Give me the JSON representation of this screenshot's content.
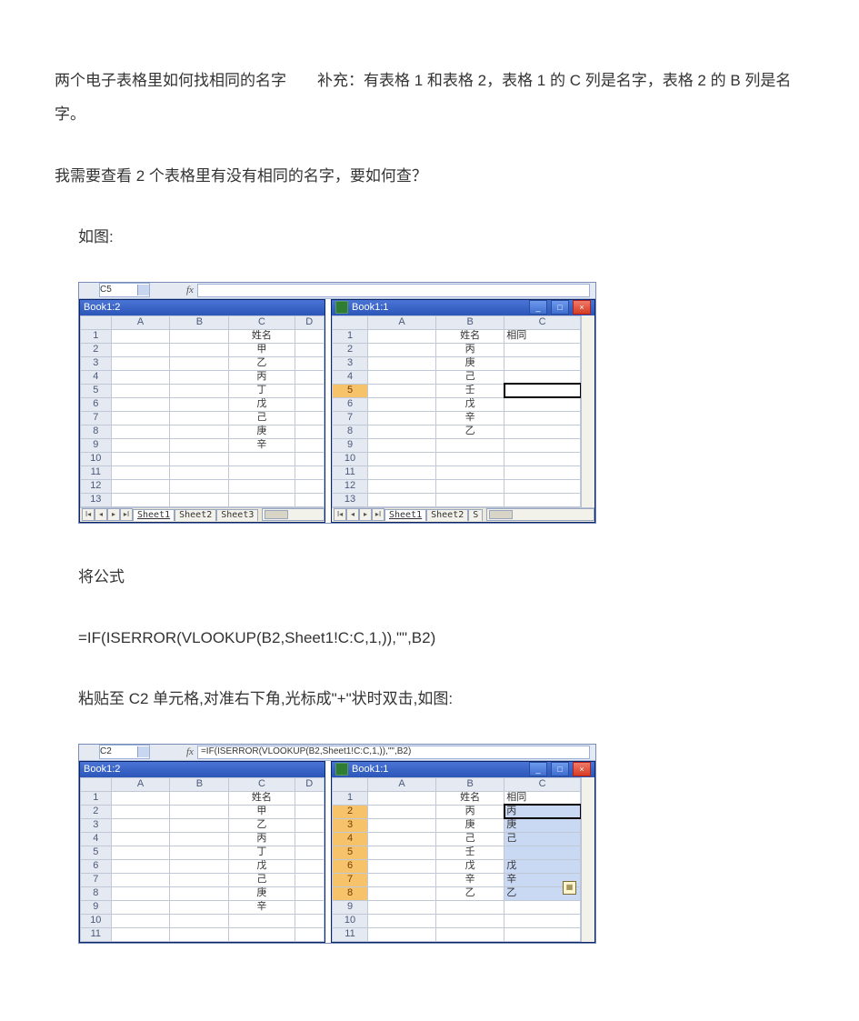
{
  "text": {
    "p1": "两个电子表格里如何找相同的名字  补充：有表格 1 和表格 2，表格 1 的 C 列是名字，表格 2 的 B 列是名字。",
    "p2": "我需要查看 2 个表格里有没有相同的名字，要如何查？",
    "p3": "如图:",
    "p4": "将公式",
    "p5": "=IF(ISERROR(VLOOKUP(B2,Sheet1!C:C,1,)),\"\",B2)",
    "p6": "粘贴至 C2 单元格,对准右下角,光标成\"+\"状时双击,如图:"
  },
  "shot1": {
    "nameBox": "C5",
    "fxLabel": "fx",
    "formula": "",
    "left": {
      "title": "Book1:2",
      "cols": [
        "A",
        "B",
        "C",
        "D"
      ],
      "rows": [
        {
          "n": "1",
          "C": "姓名"
        },
        {
          "n": "2",
          "C": "甲"
        },
        {
          "n": "3",
          "C": "乙"
        },
        {
          "n": "4",
          "C": "丙"
        },
        {
          "n": "5",
          "C": "丁"
        },
        {
          "n": "6",
          "C": "戊"
        },
        {
          "n": "7",
          "C": "己"
        },
        {
          "n": "8",
          "C": "庚"
        },
        {
          "n": "9",
          "C": "辛"
        },
        {
          "n": "10"
        },
        {
          "n": "11"
        },
        {
          "n": "12"
        },
        {
          "n": "13"
        }
      ],
      "tabs": [
        "Sheet1",
        "Sheet2",
        "Sheet3"
      ],
      "activeTab": 0
    },
    "right": {
      "title": "Book1:1",
      "cols": [
        "A",
        "B",
        "C"
      ],
      "rows": [
        {
          "n": "1",
          "B": "姓名",
          "C": "相同"
        },
        {
          "n": "2",
          "B": "丙"
        },
        {
          "n": "3",
          "B": "庚"
        },
        {
          "n": "4",
          "B": "己"
        },
        {
          "n": "5",
          "B": "壬",
          "active": "C"
        },
        {
          "n": "6",
          "B": "戊"
        },
        {
          "n": "7",
          "B": "辛"
        },
        {
          "n": "8",
          "B": "乙"
        },
        {
          "n": "9"
        },
        {
          "n": "10"
        },
        {
          "n": "11"
        },
        {
          "n": "12"
        },
        {
          "n": "13"
        }
      ],
      "selRow": "5",
      "tabs": [
        "Sheet1",
        "Sheet2",
        "S"
      ],
      "activeTab": 0,
      "winButtons": [
        "min",
        "max",
        "close"
      ]
    }
  },
  "shot2": {
    "nameBox": "C2",
    "fxLabel": "fx",
    "formula": "=IF(ISERROR(VLOOKUP(B2,Sheet1!C:C,1,)),\"\",B2)",
    "left": {
      "title": "Book1:2",
      "cols": [
        "A",
        "B",
        "C",
        "D"
      ],
      "rows": [
        {
          "n": "1",
          "C": "姓名"
        },
        {
          "n": "2",
          "C": "甲"
        },
        {
          "n": "3",
          "C": "乙"
        },
        {
          "n": "4",
          "C": "丙"
        },
        {
          "n": "5",
          "C": "丁"
        },
        {
          "n": "6",
          "C": "戊"
        },
        {
          "n": "7",
          "C": "己"
        },
        {
          "n": "8",
          "C": "庚"
        },
        {
          "n": "9",
          "C": "辛"
        },
        {
          "n": "10"
        },
        {
          "n": "11"
        }
      ]
    },
    "right": {
      "title": "Book1:1",
      "cols": [
        "A",
        "B",
        "C"
      ],
      "rows": [
        {
          "n": "1",
          "B": "姓名",
          "C": "相同"
        },
        {
          "n": "2",
          "B": "丙",
          "C": "丙",
          "sel": true,
          "active": true
        },
        {
          "n": "3",
          "B": "庚",
          "C": "庚",
          "sel": true
        },
        {
          "n": "4",
          "B": "己",
          "C": "己",
          "sel": true
        },
        {
          "n": "5",
          "B": "壬",
          "C": "",
          "sel": true
        },
        {
          "n": "6",
          "B": "戊",
          "C": "戊",
          "sel": true
        },
        {
          "n": "7",
          "B": "辛",
          "C": "辛",
          "sel": true
        },
        {
          "n": "8",
          "B": "乙",
          "C": "乙",
          "sel": true
        },
        {
          "n": "9"
        },
        {
          "n": "10"
        },
        {
          "n": "11"
        }
      ],
      "selRows": [
        "2",
        "3",
        "4",
        "5",
        "6",
        "7",
        "8"
      ],
      "winButtons": [
        "min",
        "max",
        "close"
      ],
      "autofillIcon": true
    }
  },
  "glyphs": {
    "navFirst": "Ⅰ◂",
    "navPrev": "◂",
    "navNext": "▸",
    "navLast": "▸Ⅰ",
    "min": "_",
    "max": "□",
    "close": "×",
    "af": "▦"
  }
}
